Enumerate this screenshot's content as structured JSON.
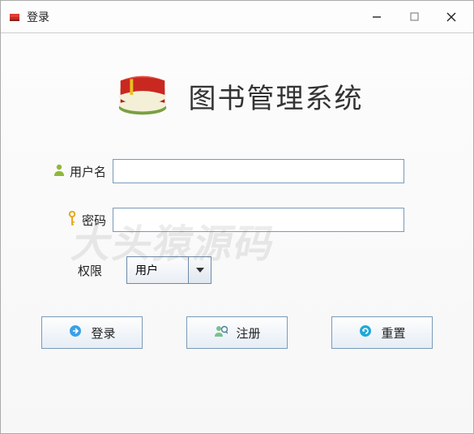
{
  "window": {
    "title": "登录"
  },
  "header": {
    "app_title": "图书管理系统"
  },
  "form": {
    "username_label": "用户名",
    "username_value": "",
    "password_label": "密码",
    "password_value": "",
    "role_label": "权限",
    "role_selected": "用户"
  },
  "buttons": {
    "login": "登录",
    "register": "注册",
    "reset": "重置"
  },
  "watermark": "大头猿源码"
}
